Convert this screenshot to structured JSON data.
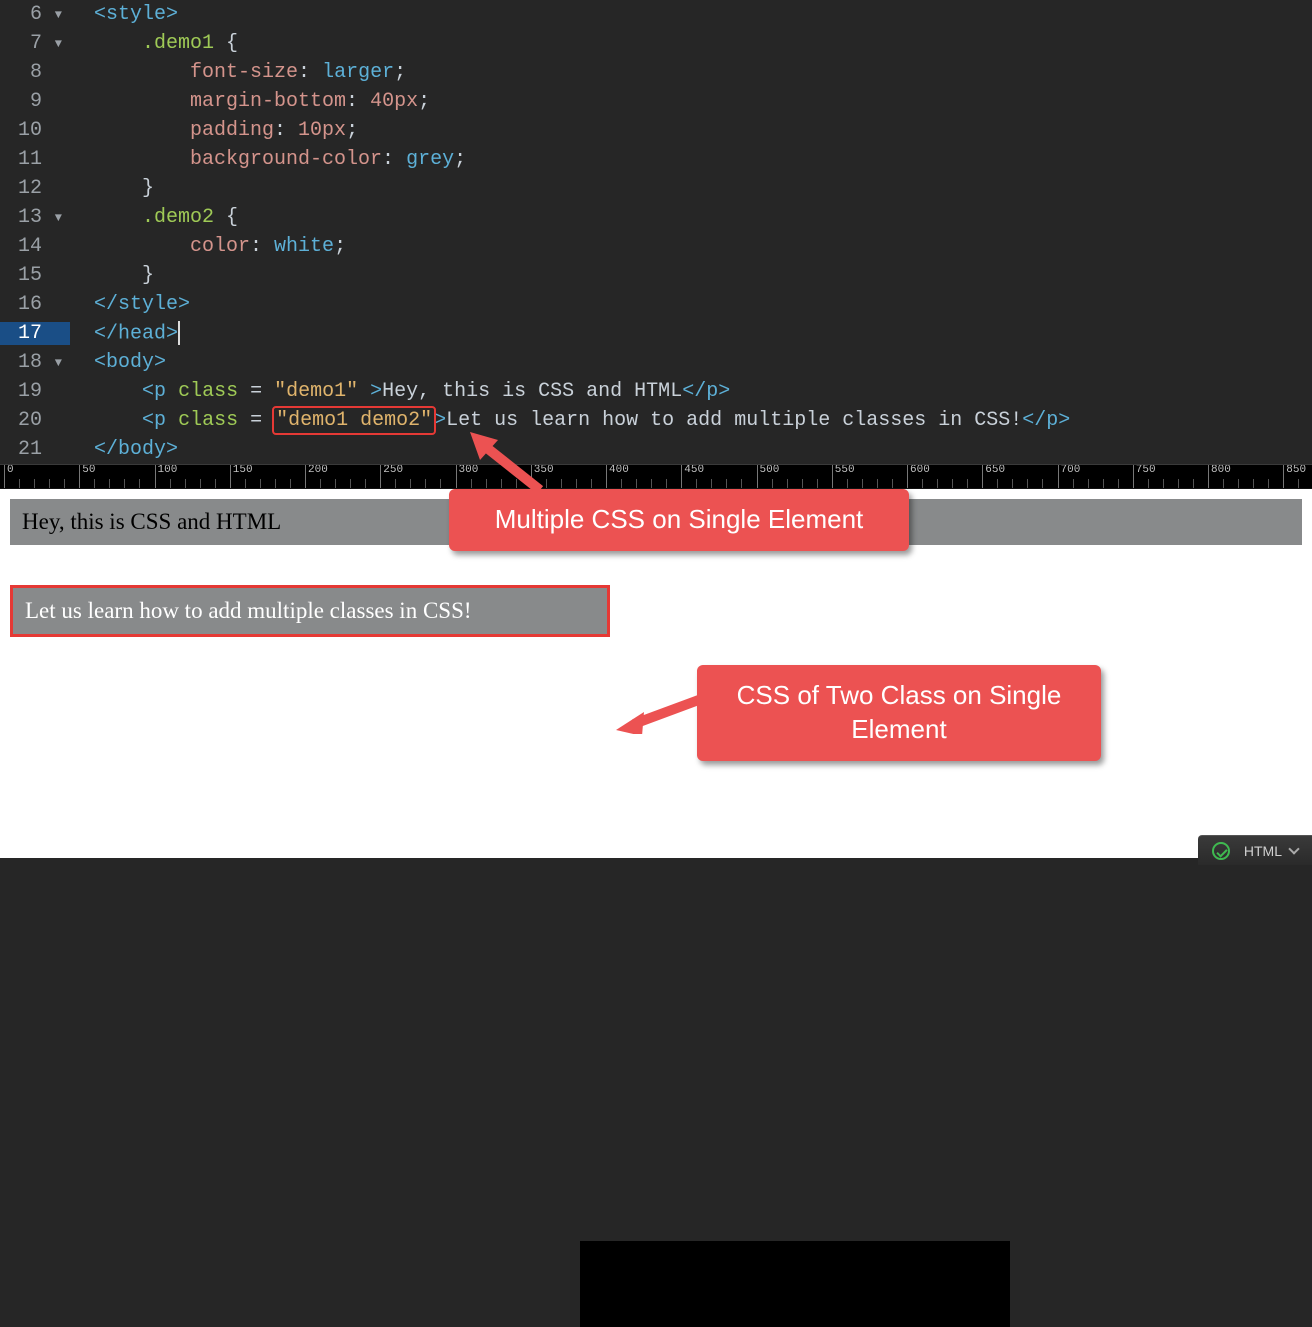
{
  "editor": {
    "lines": [
      {
        "num": "6",
        "fold": true
      },
      {
        "num": "7",
        "fold": true
      },
      {
        "num": "8"
      },
      {
        "num": "9"
      },
      {
        "num": "10"
      },
      {
        "num": "11"
      },
      {
        "num": "12"
      },
      {
        "num": "13",
        "fold": true
      },
      {
        "num": "14"
      },
      {
        "num": "15"
      },
      {
        "num": "16"
      },
      {
        "num": "17",
        "active": true
      },
      {
        "num": "18",
        "fold": true
      },
      {
        "num": "19"
      },
      {
        "num": "20"
      },
      {
        "num": "21"
      }
    ],
    "tokens": {
      "style_open": "<style>",
      "demo1_sel": ".demo1",
      "brace_open": " {",
      "font_size": "font-size",
      "larger": "larger",
      "margin_bottom": "margin-bottom",
      "mb_val": "40px",
      "padding": "padding",
      "pad_val": "10px",
      "bg": "background-color",
      "bg_val": "grey",
      "brace_close": "}",
      "demo2_sel": ".demo2",
      "color": "color",
      "white": "white",
      "style_close": "</style>",
      "head_close": "</head>",
      "body_open": "<body>",
      "p": "p",
      "class": "class",
      "eq": " = ",
      "s1": "\"demo1\"",
      "s2": "\"demo1 demo2\"",
      "txt1": "Hey, this is CSS and HTML",
      "txt2": "Let us learn how to add multiple classes in CSS!",
      "p_close": "</p>",
      "body_close": "</body>"
    }
  },
  "ruler": {
    "majors": [
      0,
      50,
      100,
      150,
      200,
      250,
      300,
      350,
      400,
      450,
      500,
      550,
      600,
      650,
      700,
      750,
      800,
      850
    ]
  },
  "preview": {
    "line1": "Hey, this is CSS and HTML",
    "line2": "Let us learn how to add multiple classes in CSS!"
  },
  "callouts": {
    "c1": "Multiple CSS on Single Element",
    "c2": "CSS of Two Class on Single Element"
  },
  "statusbar": {
    "lang": "HTML"
  }
}
